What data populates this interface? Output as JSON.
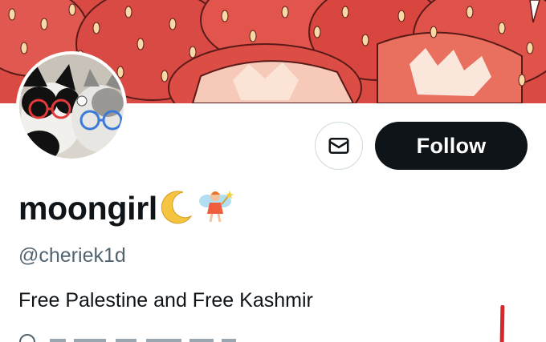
{
  "profile": {
    "display_name": "moongirl",
    "display_name_emojis": [
      "crescent-moon",
      "fairy"
    ],
    "handle": "@cheriek1d",
    "bio": "Free Palestine and Free Kashmir",
    "banner_theme": "strawberries",
    "avatar_subject": "two cats wearing glasses"
  },
  "actions": {
    "follow_label": "Follow",
    "message_icon": "envelope-icon"
  },
  "colors": {
    "follow_bg": "#0f1419",
    "follow_text": "#ffffff",
    "handle_text": "#536471",
    "primary_text": "#0f1419",
    "banner_red": "#d8463f",
    "annotation_red": "#d8262b"
  }
}
